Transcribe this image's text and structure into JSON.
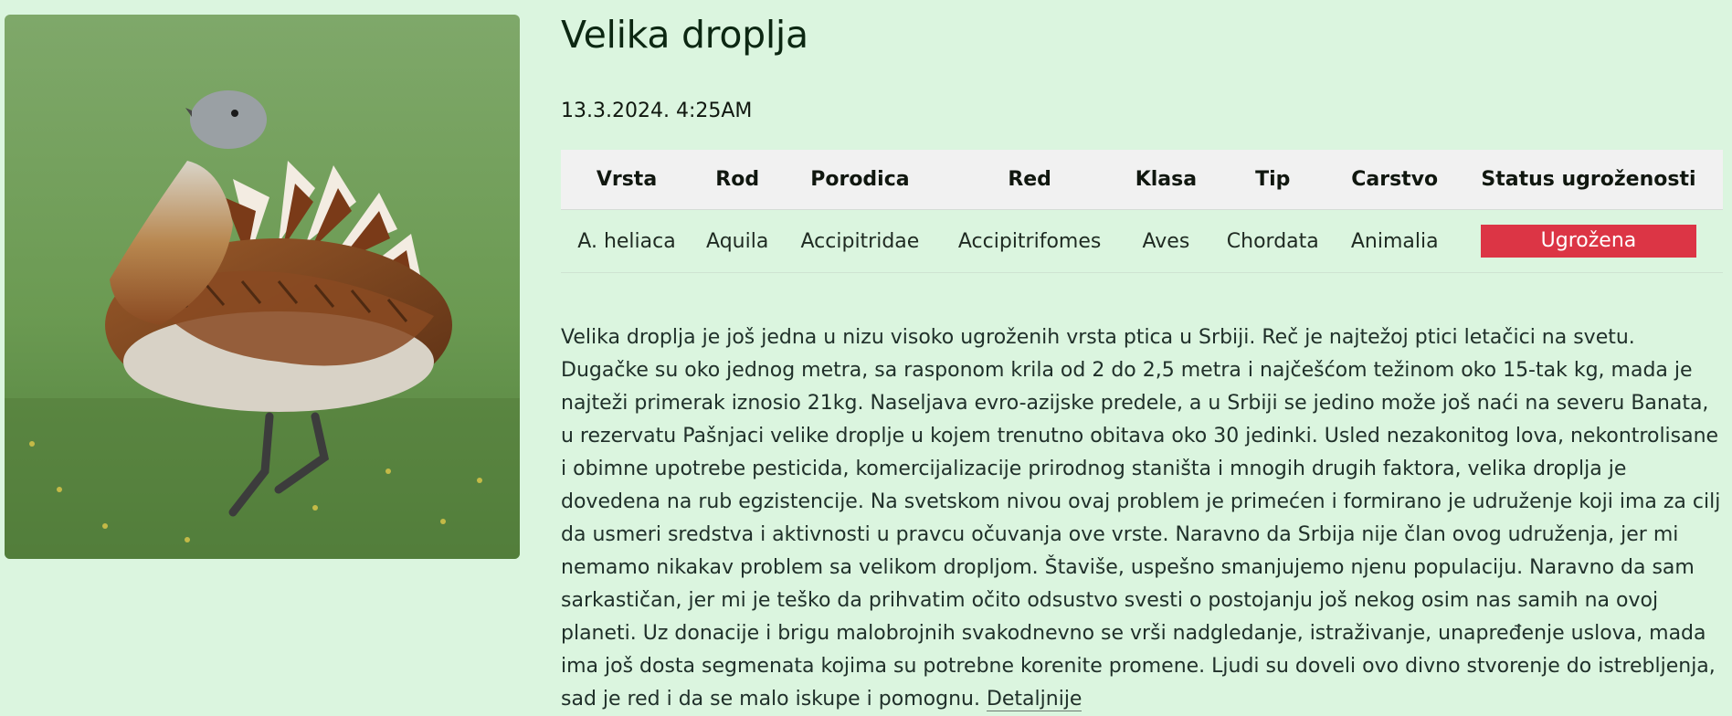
{
  "bird": {
    "name": "Velika droplja",
    "date": "13.3.2024. 4:25AM",
    "image_alt": "Velika droplja"
  },
  "taxonomy": {
    "headers": [
      "Vrsta",
      "Rod",
      "Porodica",
      "Red",
      "Klasa",
      "Tip",
      "Carstvo",
      "Status ugroženosti"
    ],
    "values": [
      "A. heliaca",
      "Aquila",
      "Accipitridae",
      "Accipitrifomes",
      "Aves",
      "Chordata",
      "Animalia"
    ],
    "status": "Ugrožena",
    "status_color": "#dc3545"
  },
  "description": {
    "text": "Velika droplja je još jedna u nizu visoko ugroženih vrsta ptica u Srbiji. Reč je najtežoj ptici letačici na svetu. Dugačke su oko jednog metra, sa rasponom krila od 2 do 2,5 metra i najčešćom težinom oko 15-tak kg, mada je najteži primerak iznosio 21kg. Naseljava evro-azijske predele, a u Srbiji se jedino može još naći na severu Banata, u rezervatu Pašnjaci velike droplje u kojem trenutno obitava oko 30 jedinki. Usled nezakonitog lova, nekontrolisane i obimne upotrebe pesticida, komercijalizacije prirodnog staništa i mnogih drugih faktora, velika droplja je dovedena na rub egzistencije. Na svetskom nivou ovaj problem je primećen i formirano je udruženje koji ima za cilj da usmeri sredstva i aktivnosti u pravcu očuvanja ove vrste. Naravno da Srbija nije član ovog udruženja, jer mi nemamo nikakav problem sa velikom dropljom. Štaviše, uspešno smanjujemo njenu populaciju. Naravno da sam sarkastičan, jer mi je teško da prihvatim očito odsustvo svesti o postojanju još nekog osim nas samih na ovoj planeti. Uz donacije i brigu malobrojnih svakodnevno se vrši nadgledanje, istraživanje, unapređenje uslova, mada ima još dosta segmenata kojima su potrebne korenite promene. Ljudi su doveli ovo divno stvorenje do istrebljenja, sad je red i da se malo iskupe i pomognu.",
    "link_label": "Detaljnije"
  },
  "colors": {
    "background": "#dbf5df",
    "table_header_bg": "#f1f1f1",
    "title": "#0c2712"
  }
}
